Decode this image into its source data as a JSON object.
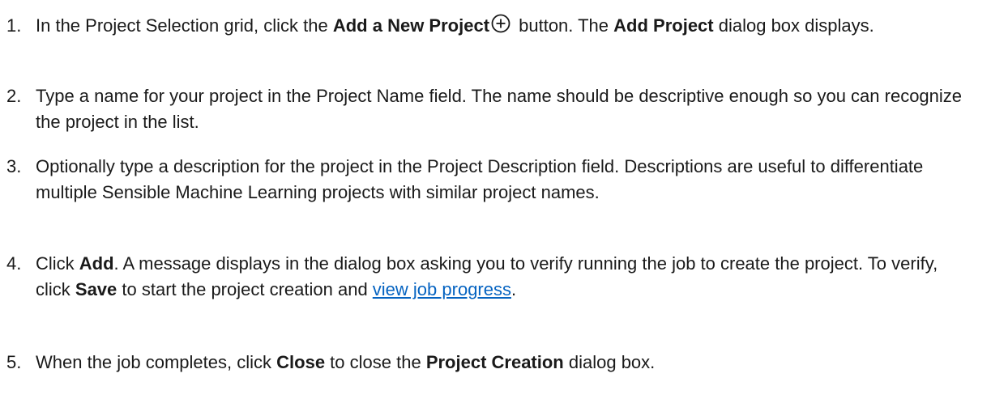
{
  "steps": [
    {
      "number": "1.",
      "t1": "In the Project Selection grid, click the ",
      "b1": "Add a New Project",
      "t2": " button. The ",
      "b2": "Add Project",
      "t3": " dialog box displays.",
      "icon": "add-circle-icon"
    },
    {
      "number": "2.",
      "t1": "Type a name for your project in the Project Name field. The name should be descriptive enough so you can recognize the project in the list."
    },
    {
      "number": "3.",
      "t1": "Optionally type a description for the project in the Project Description field. Descriptions are useful to differentiate multiple Sensible Machine Learning projects with similar project names."
    },
    {
      "number": "4.",
      "t1": "Click ",
      "b1": "Add",
      "t2": ". A message displays in the dialog box asking you to verify running the job to create the project. To verify, click ",
      "b2": "Save",
      "t3": " to start the project creation and ",
      "link": "view job progress",
      "t4": "."
    },
    {
      "number": "5.",
      "t1": "When the job completes, click ",
      "b1": "Close",
      "t2": " to close the ",
      "b2": "Project Creation",
      "t3": " dialog box."
    }
  ],
  "colors": {
    "text": "#1a1a1a",
    "link": "#0563c1",
    "icon": "#1a1a1a"
  }
}
